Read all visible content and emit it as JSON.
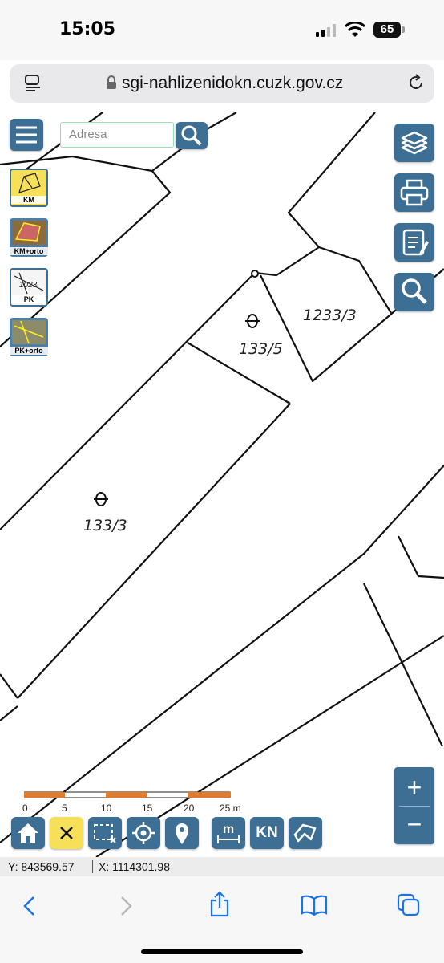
{
  "status": {
    "time": "15:05",
    "battery": "65"
  },
  "browser": {
    "url": "sgi-nahlizenidokn.cuzk.gov.cz"
  },
  "search": {
    "placeholder": "Adresa"
  },
  "layers": [
    {
      "label": "KM",
      "active": true
    },
    {
      "label": "KM+orto",
      "active": false
    },
    {
      "label": "PK",
      "active": false
    },
    {
      "label": "PK+orto",
      "active": false
    }
  ],
  "parcels": {
    "p1": "133/5",
    "p2": "1233/3",
    "p3": "133/3"
  },
  "scale": {
    "labels": [
      "0",
      "5",
      "10",
      "15",
      "20",
      "25 m"
    ],
    "colors": [
      "#e07a2c",
      "#ffffff"
    ]
  },
  "toolbar": {
    "kn_label": "KN",
    "measure_label": "m"
  },
  "zoom": {
    "in": "+",
    "out": "−"
  },
  "coords": {
    "y": "Y: 843569.57",
    "x": "X: 1114301.98"
  },
  "colors": {
    "accent": "#3d6f95",
    "highlight": "#f6e05a"
  }
}
